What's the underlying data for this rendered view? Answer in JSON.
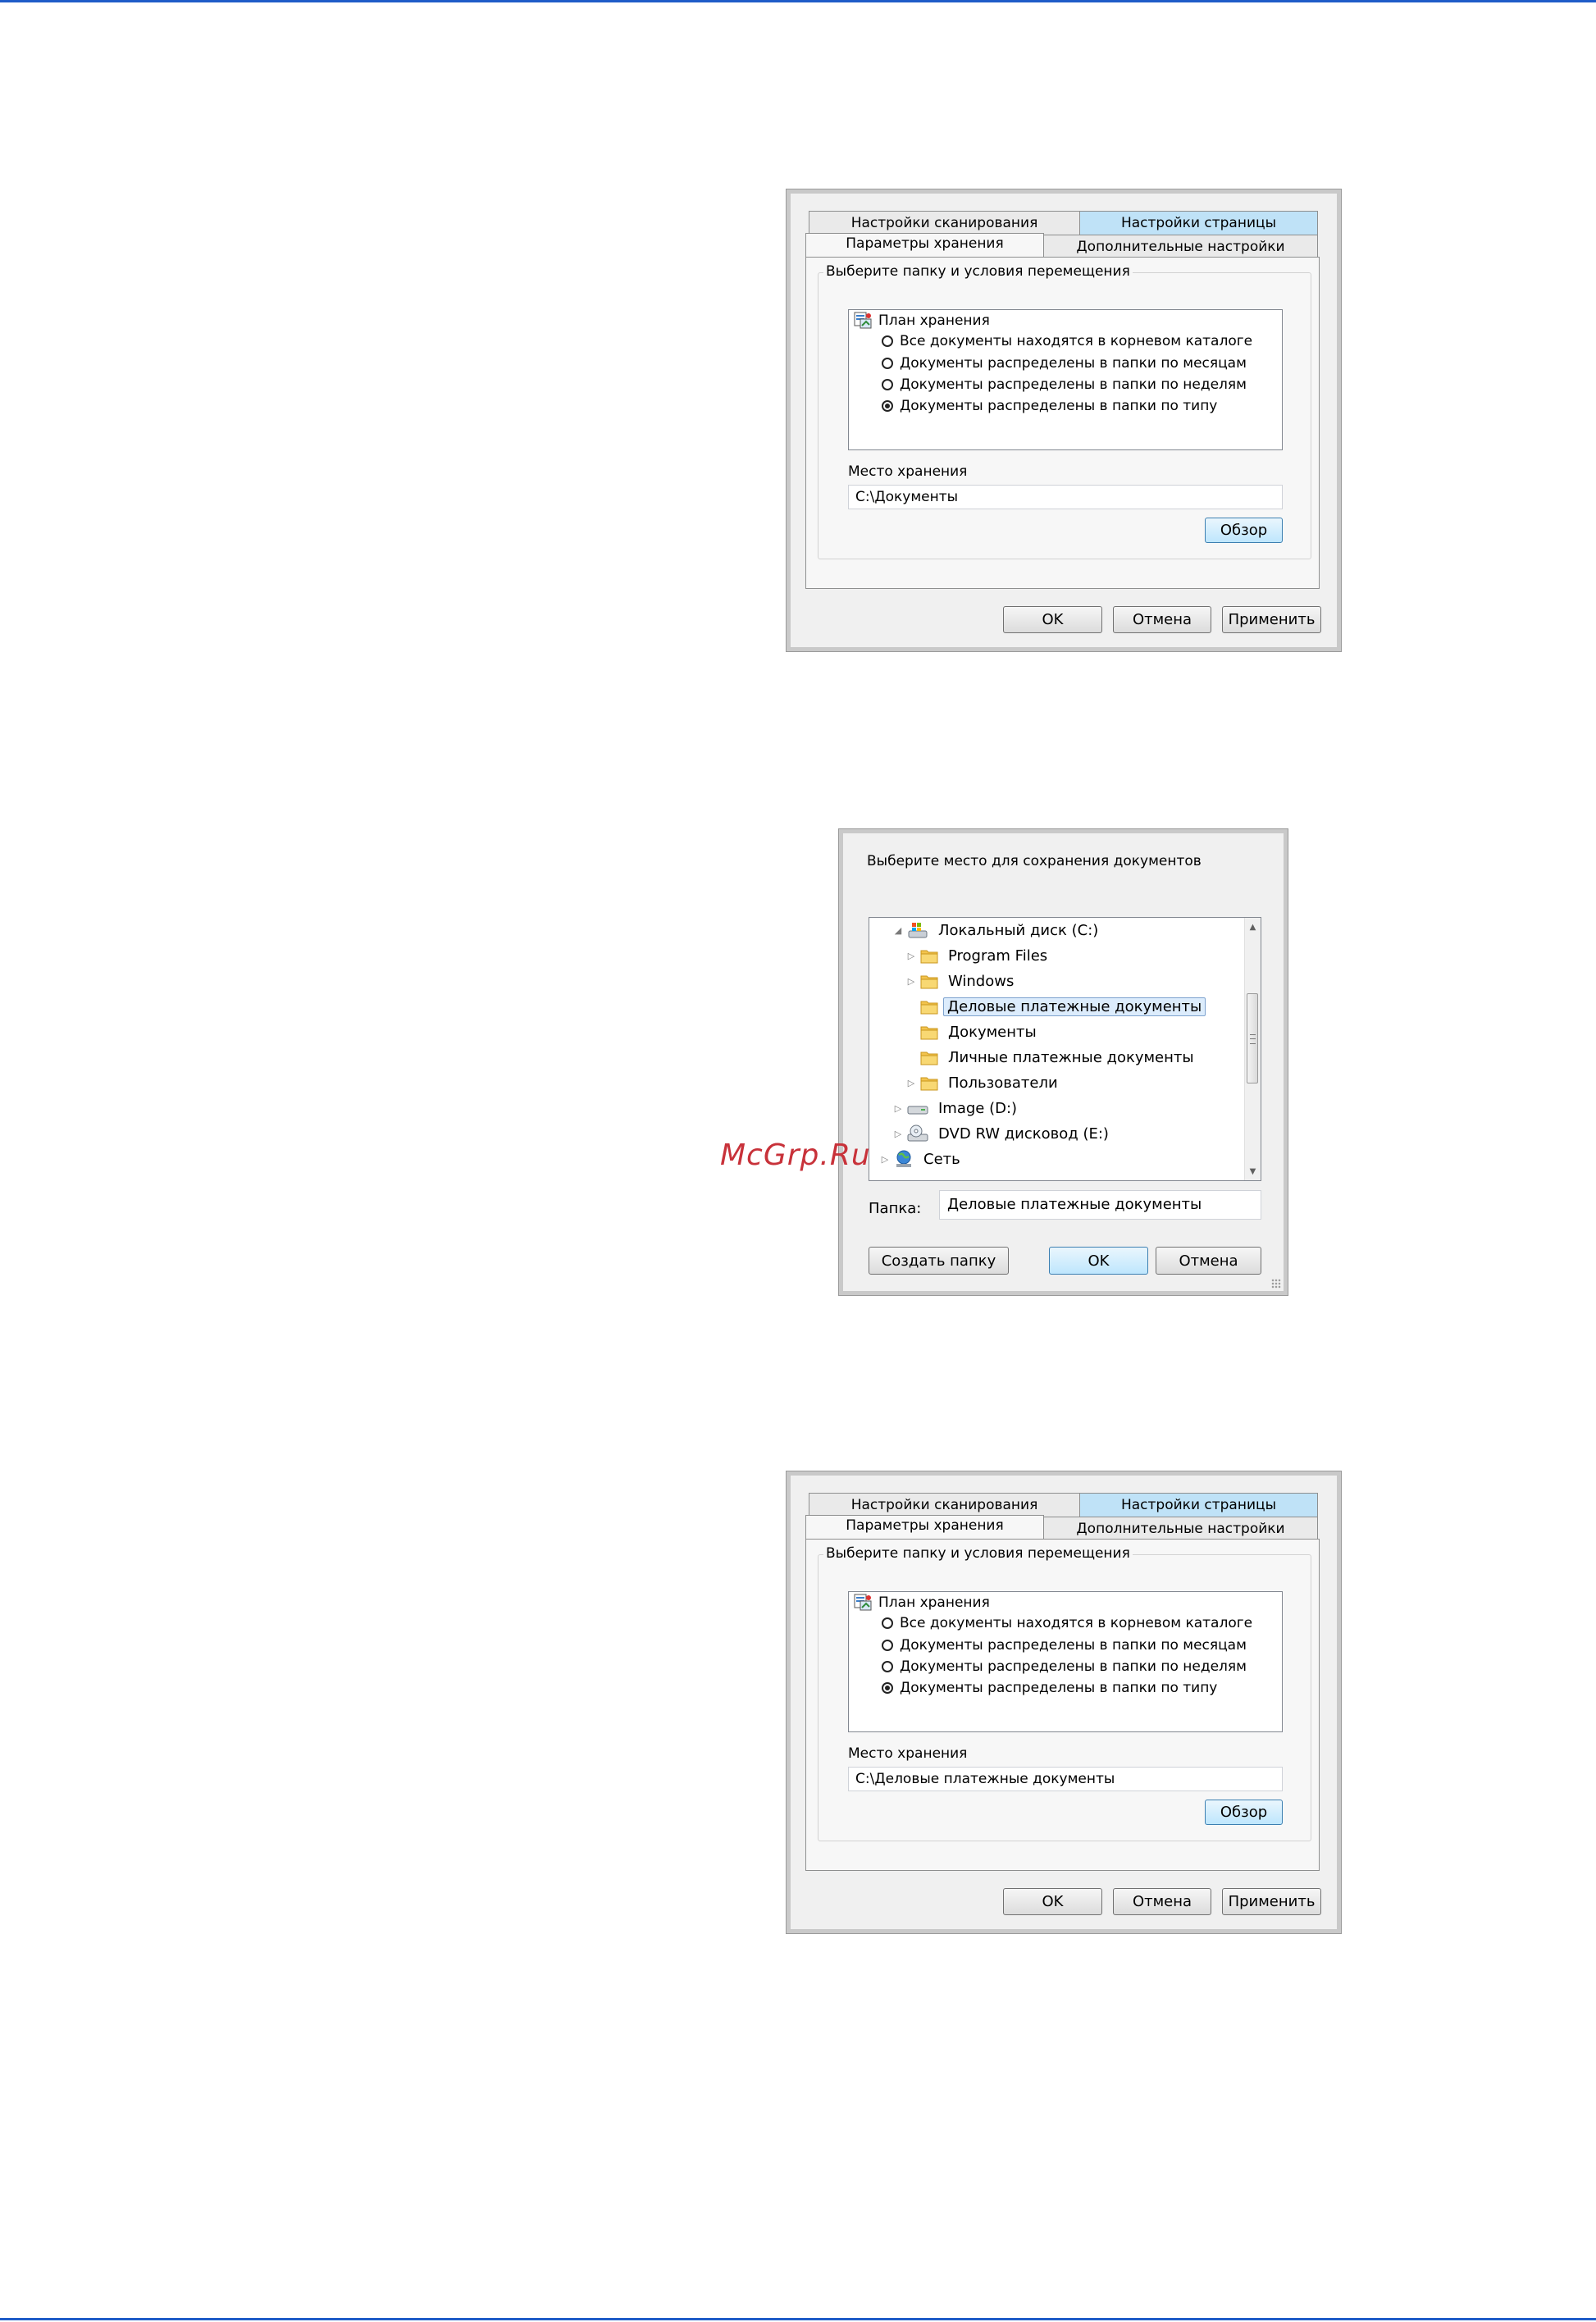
{
  "watermark": "McGrp.Ru",
  "settings_dialogs": [
    {
      "tabs": {
        "scan_settings": "Настройки сканирования",
        "page_settings": "Настройки страницы",
        "storage_options": "Параметры хранения",
        "advanced_settings": "Дополнительные настройки"
      },
      "group_title": "Выберите папку и условия перемещения",
      "plan_label": "План хранения",
      "options": [
        {
          "label": "Все документы находятся в корневом каталоге",
          "checked": false
        },
        {
          "label": "Документы распределены в папки по месяцам",
          "checked": false
        },
        {
          "label": "Документы распределены в папки по неделям",
          "checked": false
        },
        {
          "label": "Документы распределены в папки по типу",
          "checked": true
        }
      ],
      "location_label": "Место хранения",
      "location_value": "C:\\Документы",
      "browse_button": "Обзор",
      "ok_button": "OK",
      "cancel_button": "Отмена",
      "apply_button": "Применить"
    },
    {
      "tabs": {
        "scan_settings": "Настройки сканирования",
        "page_settings": "Настройки страницы",
        "storage_options": "Параметры хранения",
        "advanced_settings": "Дополнительные настройки"
      },
      "group_title": "Выберите папку и условия перемещения",
      "plan_label": "План хранения",
      "options": [
        {
          "label": "Все документы находятся в корневом каталоге",
          "checked": false
        },
        {
          "label": "Документы распределены в папки по месяцам",
          "checked": false
        },
        {
          "label": "Документы распределены в папки по неделям",
          "checked": false
        },
        {
          "label": "Документы распределены в папки по типу",
          "checked": true
        }
      ],
      "location_label": "Место хранения",
      "location_value": "C:\\Деловые платежные документы",
      "browse_button": "Обзор",
      "ok_button": "OK",
      "cancel_button": "Отмена",
      "apply_button": "Применить"
    }
  ],
  "folder_dialog": {
    "prompt": "Выберите место для сохранения документов",
    "tree": [
      {
        "label": "Локальный диск (C:)",
        "icon": "local-disk-icon",
        "expander": "expanded"
      },
      {
        "label": "Program Files",
        "icon": "folder-icon",
        "expander": "collapsed"
      },
      {
        "label": "Windows",
        "icon": "folder-icon",
        "expander": "collapsed"
      },
      {
        "label": "Деловые платежные документы",
        "icon": "folder-icon",
        "expander": "none",
        "selected": true
      },
      {
        "label": "Документы",
        "icon": "folder-icon",
        "expander": "none"
      },
      {
        "label": "Личные платежные документы",
        "icon": "folder-icon",
        "expander": "none"
      },
      {
        "label": "Пользователи",
        "icon": "folder-icon",
        "expander": "collapsed"
      },
      {
        "label": "Image (D:)",
        "icon": "drive-icon",
        "expander": "collapsed"
      },
      {
        "label": "DVD RW дисковод (E:)",
        "icon": "dvd-drive-icon",
        "expander": "collapsed"
      },
      {
        "label": "Сеть",
        "icon": "network-icon",
        "expander": "collapsed"
      }
    ],
    "folder_label": "Папка:",
    "folder_value": "Деловые платежные документы",
    "new_folder_button": "Создать папку",
    "ok_button": "OK",
    "cancel_button": "Отмена"
  },
  "colors": {
    "page_rule": "#1f5cc8",
    "active_tab": "#bfe2f7",
    "watermark": "#c8323a"
  }
}
